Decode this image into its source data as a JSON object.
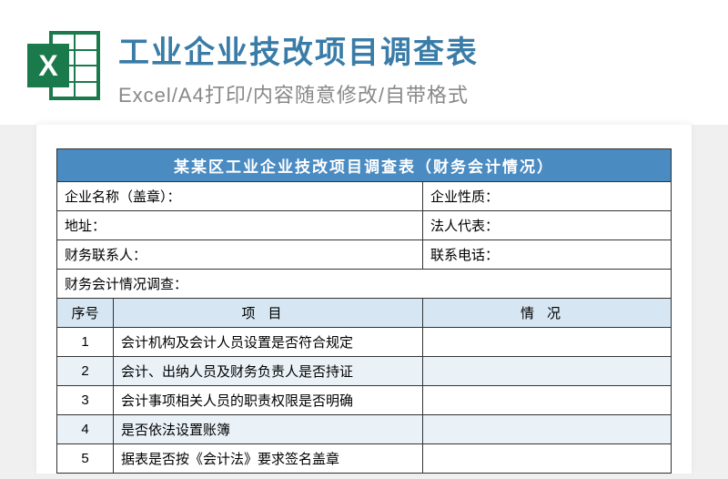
{
  "header": {
    "title": "工业企业技改项目调查表",
    "subtitle": "Excel/A4打印/内容随意修改/自带格式",
    "icon_letter": "X"
  },
  "form": {
    "title": "某某区工业企业技改项目调查表（财务会计情况）",
    "info_rows": [
      {
        "left": "企业名称（盖章）：",
        "right": "企业性质："
      },
      {
        "left": "地址：",
        "right": "法人代表："
      },
      {
        "left": "财务联系人：",
        "right": "联系电话："
      }
    ],
    "section_label": "财务会计情况调查：",
    "columns": {
      "seq": "序号",
      "item": "项目",
      "status": "情况"
    },
    "rows": [
      {
        "seq": "1",
        "item": "会计机构及会计人员设置是否符合规定",
        "status": ""
      },
      {
        "seq": "2",
        "item": "会计、出纳人员及财务负责人是否持证",
        "status": ""
      },
      {
        "seq": "3",
        "item": "会计事项相关人员的职责权限是否明确",
        "status": ""
      },
      {
        "seq": "4",
        "item": "是否依法设置账簿",
        "status": ""
      },
      {
        "seq": "5",
        "item": "据表是否按《会计法》要求签名盖章",
        "status": ""
      }
    ]
  }
}
